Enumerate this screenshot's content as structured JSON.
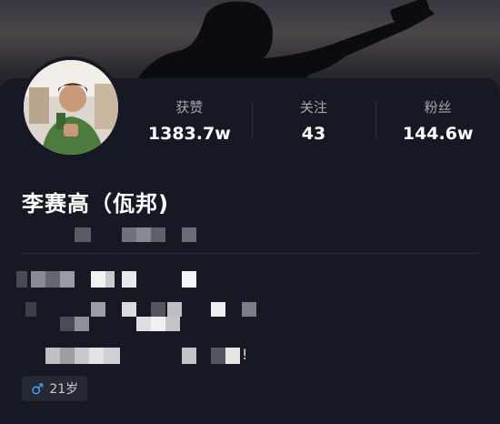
{
  "profile": {
    "display_name": "李赛高（佤邦)",
    "avatar_icon": "avatar-photo",
    "stats": [
      {
        "label": "获赞",
        "value": "1383.7w"
      },
      {
        "label": "关注",
        "value": "43"
      },
      {
        "label": "粉丝",
        "value": "144.6w"
      }
    ],
    "tag": {
      "gender_icon": "♂",
      "age": "21岁"
    },
    "bio_tail": "!"
  },
  "colors": {
    "background": "#161823",
    "accent_male": "#4ba3ff",
    "text_primary": "#ffffff",
    "text_secondary": "#a6a7ab"
  }
}
